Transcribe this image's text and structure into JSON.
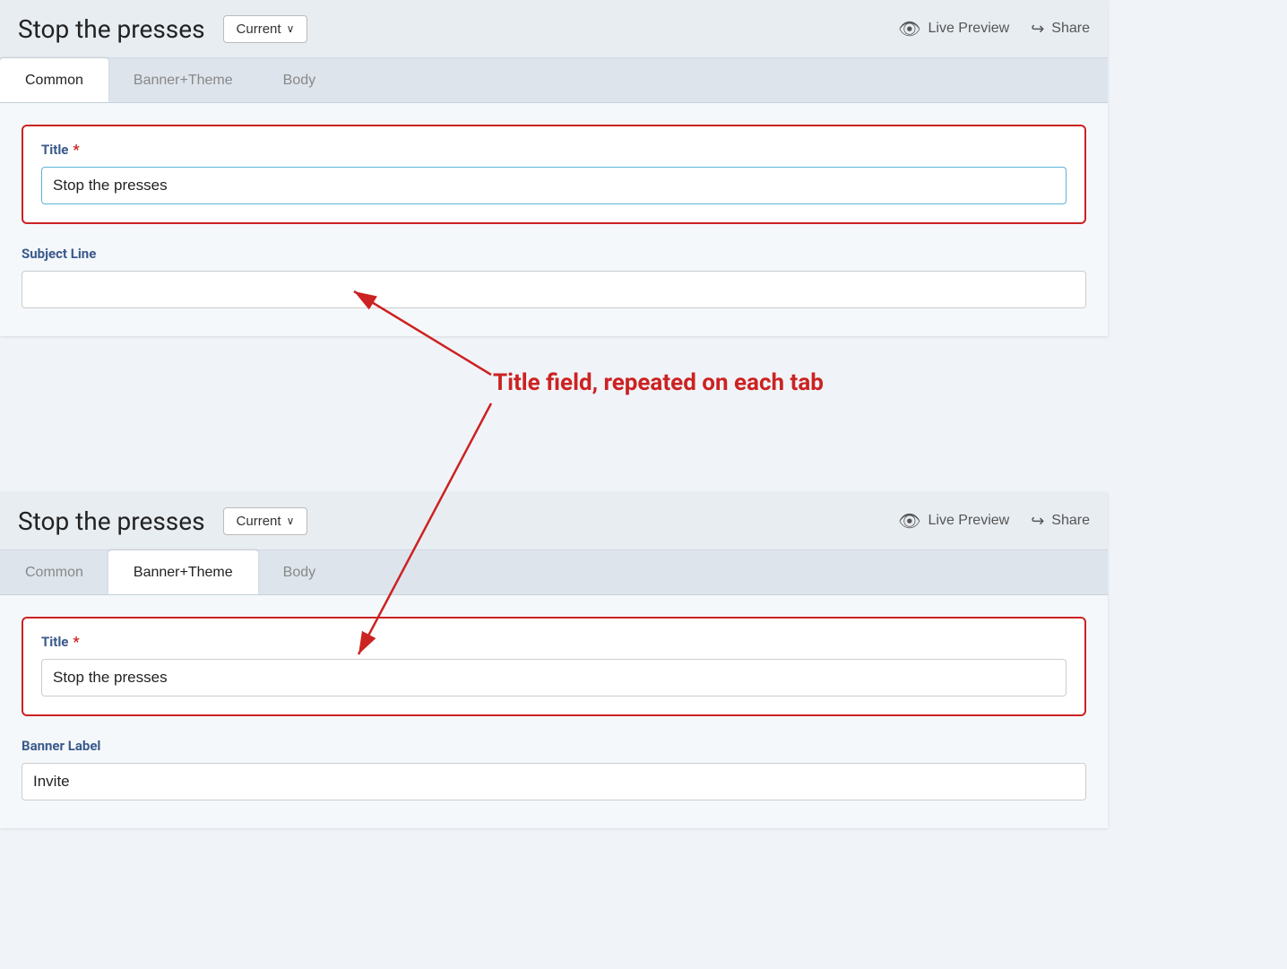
{
  "app": {
    "title": "Stop the presses"
  },
  "panel_top": {
    "header": {
      "title": "Stop the presses",
      "version_label": "Current",
      "live_preview_label": "Live Preview",
      "share_label": "Share"
    },
    "tabs": [
      {
        "id": "common",
        "label": "Common",
        "active": true
      },
      {
        "id": "banner-theme",
        "label": "Banner+Theme",
        "active": false
      },
      {
        "id": "body",
        "label": "Body",
        "active": false
      }
    ],
    "form": {
      "title_label": "Title",
      "title_value": "Stop the presses",
      "subject_line_label": "Subject Line",
      "subject_line_value": ""
    }
  },
  "panel_bottom": {
    "header": {
      "title": "Stop the presses",
      "version_label": "Current",
      "live_preview_label": "Live Preview",
      "share_label": "Share"
    },
    "tabs": [
      {
        "id": "common",
        "label": "Common",
        "active": false
      },
      {
        "id": "banner-theme",
        "label": "Banner+Theme",
        "active": true
      },
      {
        "id": "body",
        "label": "Body",
        "active": false
      }
    ],
    "form": {
      "title_label": "Title",
      "title_value": "Stop the presses",
      "banner_label_label": "Banner Label",
      "banner_label_value": "Invite"
    }
  },
  "annotation": {
    "text": "Title field, repeated on each tab"
  },
  "icons": {
    "eye": "👁",
    "share": "↪",
    "chevron_down": "∨"
  }
}
